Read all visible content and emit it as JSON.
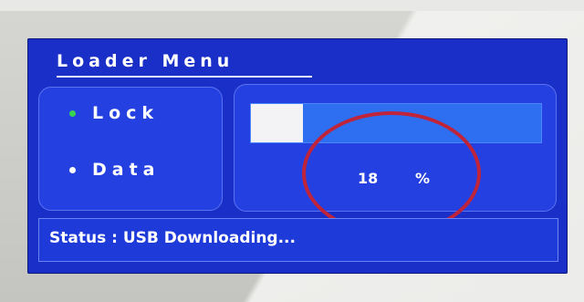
{
  "dialog": {
    "title": "Loader Menu"
  },
  "menu": {
    "items": [
      {
        "label": "Lock",
        "dot_color": "#39d353",
        "active": true
      },
      {
        "label": "Data",
        "dot_color": "#ffffff",
        "active": false
      }
    ]
  },
  "progress": {
    "value": "18",
    "unit": "%",
    "fraction": 0.18
  },
  "status": {
    "text": "Status : USB Downloading..."
  },
  "colors": {
    "panel_blue": "#1a2fc8",
    "progress_blue": "#2e6ef0",
    "highlight_ellipse": "#c0243a"
  }
}
